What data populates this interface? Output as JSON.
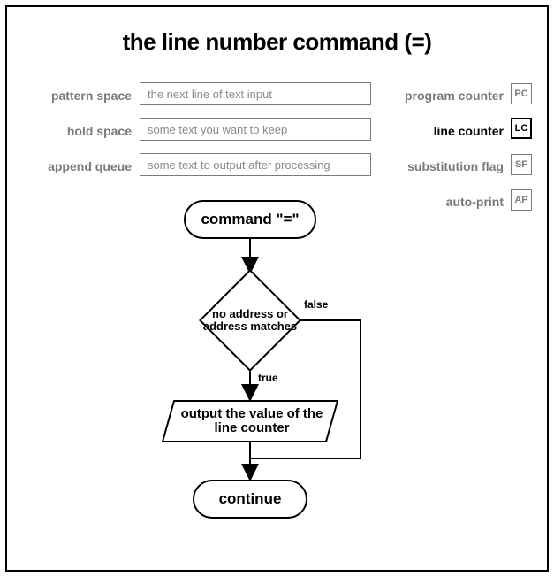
{
  "title": "the line number command (=)",
  "left_rows": [
    {
      "label": "pattern space",
      "value": "the next line of text input"
    },
    {
      "label": "hold space",
      "value": "some text you want to keep"
    },
    {
      "label": "append queue",
      "value": "some text to output after processing"
    }
  ],
  "right_rows": [
    {
      "label": "program counter",
      "abbr": "PC",
      "highlight": false
    },
    {
      "label": "line counter",
      "abbr": "LC",
      "highlight": true
    },
    {
      "label": "substitution flag",
      "abbr": "SF",
      "highlight": false
    },
    {
      "label": "auto-print",
      "abbr": "AP",
      "highlight": false
    }
  ],
  "flow": {
    "start": "command \"=\"",
    "decision": "no address or address matches",
    "decision_true_label": "true",
    "decision_false_label": "false",
    "process": "output the value of the line counter",
    "end": "continue"
  }
}
